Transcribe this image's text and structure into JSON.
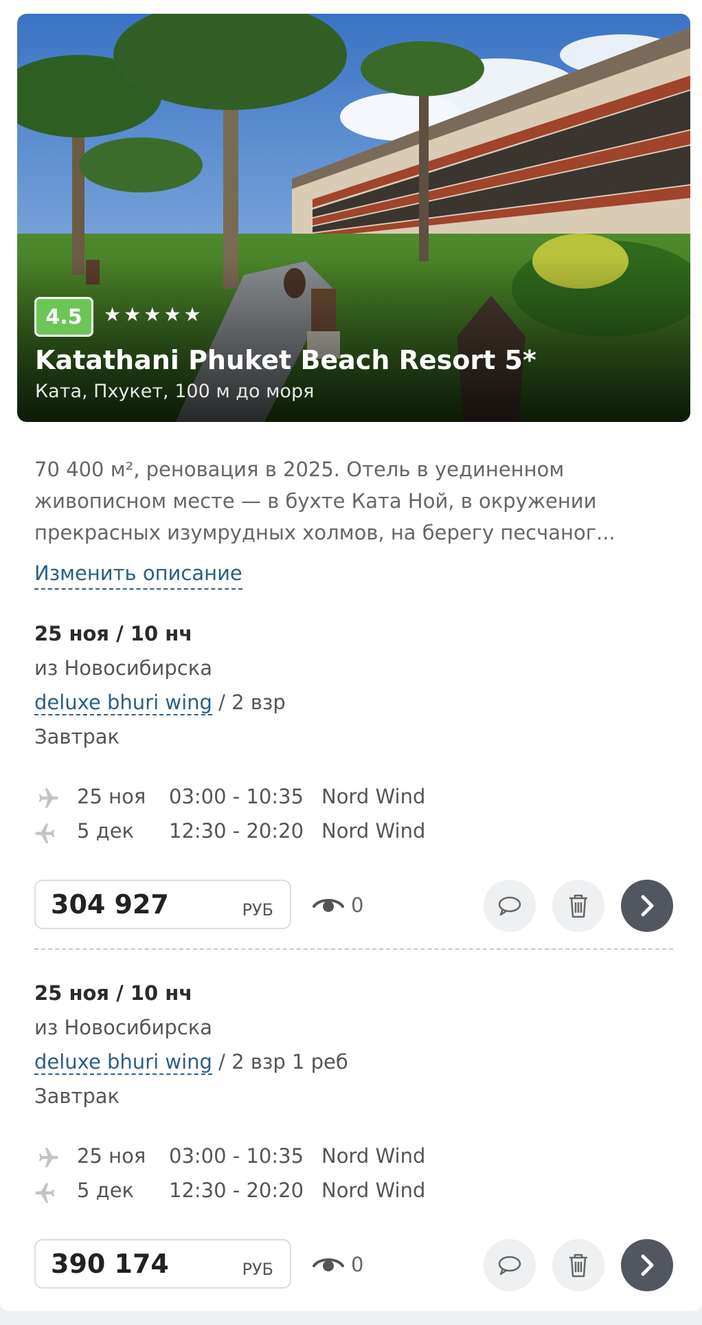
{
  "hotel": {
    "rating": "4.5",
    "stars": 5,
    "name": "Katathani Phuket Beach Resort 5*",
    "location": "Ката, Пхукет, 100 м до моря",
    "description_lines": [
      "70 400 м², реновация в 2025. Отель в уединенном",
      "живописном месте — в бухте Ката Ной, в окружении",
      "прекрасных изумрудных холмов, на берегу песчаног..."
    ],
    "edit_description_label": "Изменить описание"
  },
  "offers": [
    {
      "dates": "25 ноя / 10 нч",
      "departure": "из Новосибирска",
      "room": "deluxe bhuri wing",
      "guests": "/ 2 взр",
      "meal": "Завтрак",
      "flights": [
        {
          "direction": "outbound",
          "date": "25 ноя",
          "time": "03:00 - 10:35",
          "airline": "Nord Wind"
        },
        {
          "direction": "return",
          "date": "5 дек",
          "time": "12:30 - 20:20",
          "airline": "Nord Wind"
        }
      ],
      "price": "304 927",
      "currency": "РУБ",
      "views": "0"
    },
    {
      "dates": "25 ноя / 10 нч",
      "departure": "из Новосибирска",
      "room": "deluxe bhuri wing",
      "guests": "/ 2 взр 1 реб",
      "meal": "Завтрак",
      "flights": [
        {
          "direction": "outbound",
          "date": "25 ноя",
          "time": "03:00 - 10:35",
          "airline": "Nord Wind"
        },
        {
          "direction": "return",
          "date": "5 дек",
          "time": "12:30 - 20:20",
          "airline": "Nord Wind"
        }
      ],
      "price": "390 174",
      "currency": "РУБ",
      "views": "0"
    }
  ],
  "icons": {
    "star": "star-icon",
    "plane": "plane-icon",
    "eye": "eye-icon",
    "comment": "comment-icon",
    "trash": "trash-icon",
    "next": "chevron-right-icon"
  },
  "colors": {
    "rating_badge": "#6cc655",
    "link": "#2a5f86",
    "next_button": "#52565e",
    "round_button": "#eef0f2"
  }
}
